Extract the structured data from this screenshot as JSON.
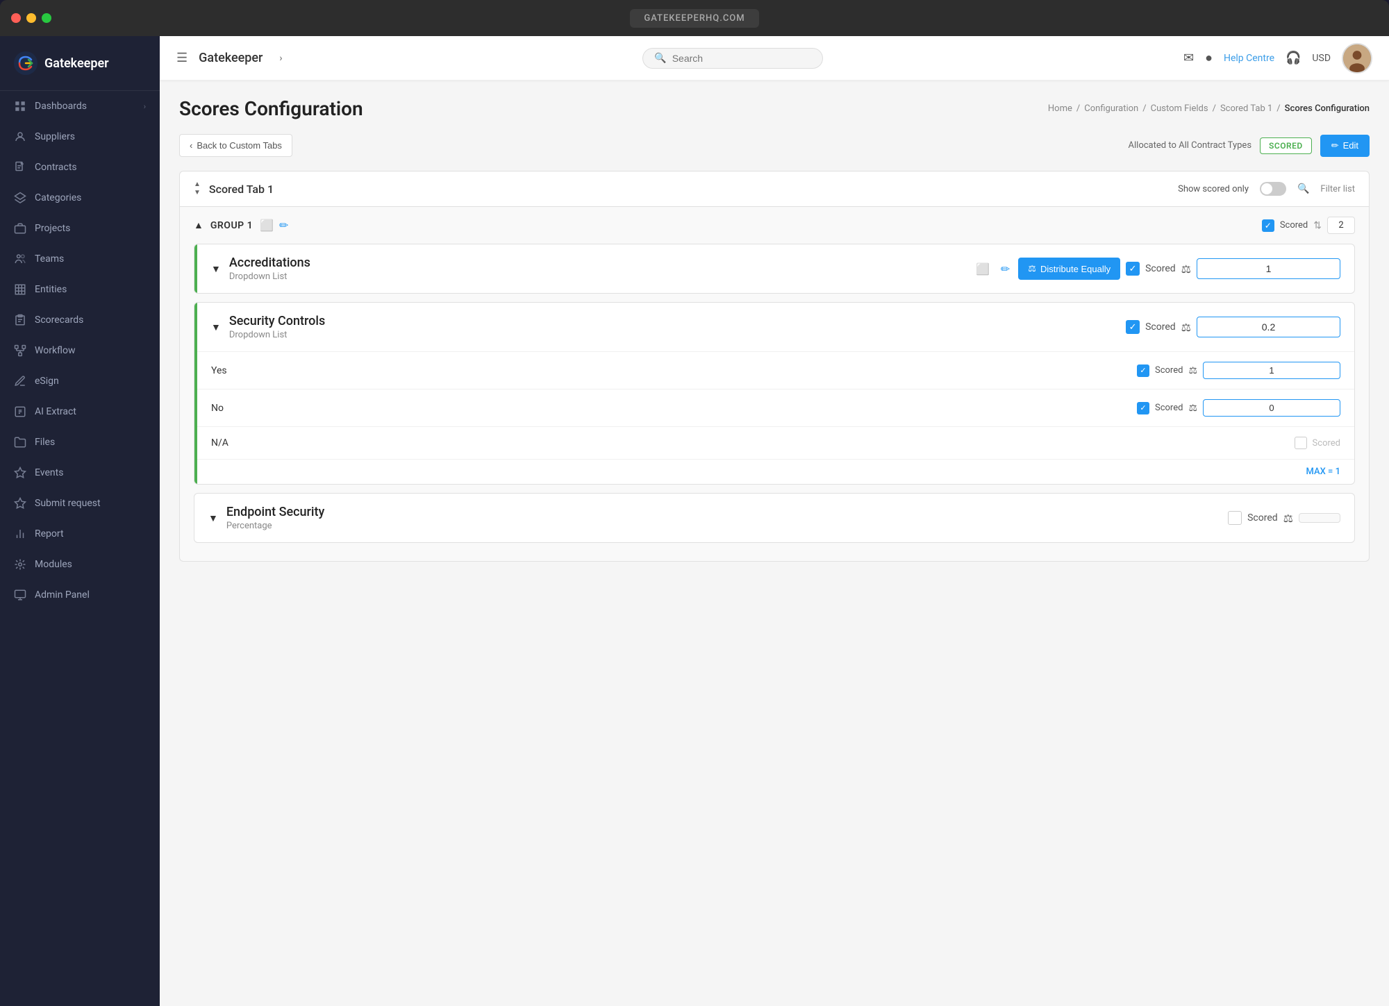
{
  "titleBar": {
    "url": "GATEKEEPERHQ.COM",
    "closeLabel": "close",
    "minLabel": "minimize",
    "maxLabel": "maximize"
  },
  "sidebar": {
    "logo": "Gatekeeper",
    "items": [
      {
        "id": "dashboards",
        "label": "Dashboards",
        "icon": "grid",
        "hasArrow": true
      },
      {
        "id": "suppliers",
        "label": "Suppliers",
        "icon": "user",
        "hasArrow": false
      },
      {
        "id": "contracts",
        "label": "Contracts",
        "icon": "file",
        "hasArrow": false
      },
      {
        "id": "categories",
        "label": "Categories",
        "icon": "layers",
        "hasArrow": false
      },
      {
        "id": "projects",
        "label": "Projects",
        "icon": "briefcase",
        "hasArrow": false
      },
      {
        "id": "teams",
        "label": "Teams",
        "icon": "users",
        "hasArrow": false
      },
      {
        "id": "entities",
        "label": "Entities",
        "icon": "building",
        "hasArrow": false
      },
      {
        "id": "scorecards",
        "label": "Scorecards",
        "icon": "clipboard",
        "hasArrow": false
      },
      {
        "id": "workflow",
        "label": "Workflow",
        "icon": "workflow",
        "hasArrow": false
      },
      {
        "id": "esign",
        "label": "eSign",
        "icon": "pen",
        "hasArrow": false
      },
      {
        "id": "ai-extract",
        "label": "AI Extract",
        "icon": "ai",
        "hasArrow": false
      },
      {
        "id": "files",
        "label": "Files",
        "icon": "folder",
        "hasArrow": false
      },
      {
        "id": "events",
        "label": "Events",
        "icon": "star",
        "hasArrow": false
      },
      {
        "id": "submit-request",
        "label": "Submit request",
        "icon": "star",
        "hasArrow": false
      },
      {
        "id": "report",
        "label": "Report",
        "icon": "chart",
        "hasArrow": false
      },
      {
        "id": "modules",
        "label": "Modules",
        "icon": "modules",
        "hasArrow": false
      },
      {
        "id": "admin-panel",
        "label": "Admin Panel",
        "icon": "admin",
        "hasArrow": false
      }
    ]
  },
  "topnav": {
    "menuLabel": "☰",
    "title": "Gatekeeper",
    "titleArrow": "›",
    "searchPlaceholder": "Search",
    "helpLabel": "Help Centre",
    "currencyLabel": "USD",
    "userIcon": "👤"
  },
  "pageHeader": {
    "title": "Scores Configuration",
    "breadcrumb": [
      {
        "label": "Home",
        "link": true
      },
      {
        "label": "Configuration",
        "link": true
      },
      {
        "label": "Custom Fields",
        "link": true
      },
      {
        "label": "Scored Tab 1",
        "link": true
      },
      {
        "label": "Scores Configuration",
        "link": false,
        "current": true
      }
    ],
    "breadcrumbSeparator": "/"
  },
  "toolbar": {
    "backLabel": "Back to Custom Tabs",
    "allocatedLabel": "Allocated to All Contract Types",
    "scoredBadge": "SCORED",
    "editLabel": "Edit"
  },
  "tabSection": {
    "tabName": "Scored Tab 1",
    "showScoredLabel": "Show scored only",
    "filterLabel": "Filter list"
  },
  "group": {
    "name": "GROUP 1",
    "scoredLabel": "Scored",
    "scoreValue": "2"
  },
  "fields": [
    {
      "id": "accreditations",
      "name": "Accreditations",
      "type": "Dropdown List",
      "hasDistribute": true,
      "distributeLabel": "Distribute Equally",
      "scored": true,
      "scoredLabel": "Scored",
      "scoreValue": "1",
      "hasGreenAccent": true,
      "rows": []
    },
    {
      "id": "security-controls",
      "name": "Security Controls",
      "type": "Dropdown List",
      "hasDistribute": false,
      "scored": true,
      "scoredLabel": "Scored",
      "scoreValue": "0.2",
      "hasGreenAccent": true,
      "rows": [
        {
          "label": "Yes",
          "scored": true,
          "scoredLabel": "Scored",
          "scoreValue": "1"
        },
        {
          "label": "No",
          "scored": true,
          "scoredLabel": "Scored",
          "scoreValue": "0"
        },
        {
          "label": "N/A",
          "scored": false,
          "scoredLabel": "Scored",
          "scoreValue": ""
        }
      ],
      "maxLabel": "MAX = 1"
    },
    {
      "id": "endpoint-security",
      "name": "Endpoint Security",
      "type": "Percentage",
      "hasDistribute": false,
      "scored": false,
      "scoredLabel": "Scored",
      "scoreValue": "",
      "hasGreenAccent": false,
      "rows": []
    }
  ]
}
